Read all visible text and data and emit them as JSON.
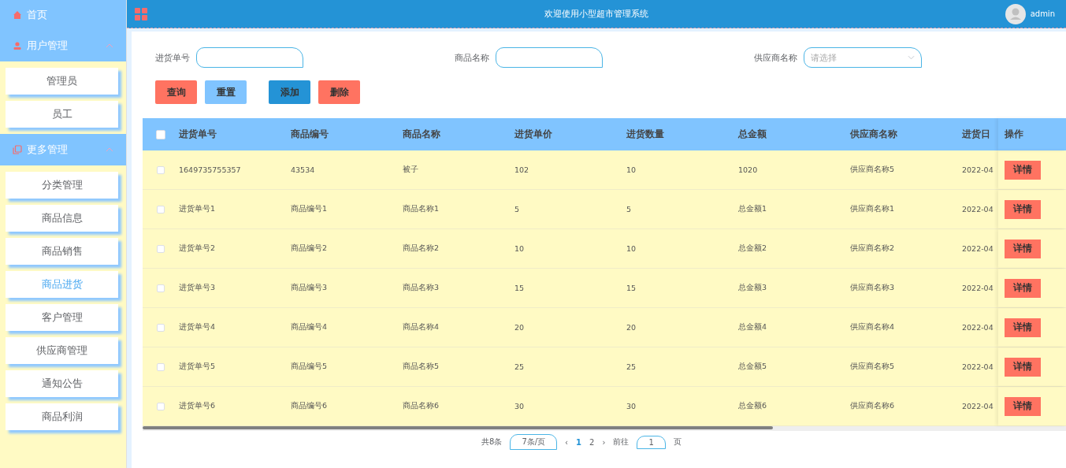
{
  "sidebar": {
    "home": {
      "label": "首页"
    },
    "groups": [
      {
        "label": "用户管理",
        "expanded": true,
        "items": [
          {
            "label": "管理员",
            "selected": false
          },
          {
            "label": "员工",
            "selected": false
          }
        ]
      },
      {
        "label": "更多管理",
        "expanded": true,
        "items": [
          {
            "label": "分类管理",
            "selected": false
          },
          {
            "label": "商品信息",
            "selected": false
          },
          {
            "label": "商品销售",
            "selected": false
          },
          {
            "label": "商品进货",
            "selected": true
          },
          {
            "label": "客户管理",
            "selected": false
          },
          {
            "label": "供应商管理",
            "selected": false
          },
          {
            "label": "通知公告",
            "selected": false
          },
          {
            "label": "商品利润",
            "selected": false
          }
        ]
      }
    ]
  },
  "header": {
    "title": "欢迎使用小型超市管理系统",
    "user": "admin"
  },
  "filters": [
    {
      "label": "进货单号",
      "kind": "input"
    },
    {
      "label": "商品名称",
      "kind": "input"
    },
    {
      "label": "供应商名称",
      "kind": "select",
      "placeholder": "请选择"
    }
  ],
  "buttons": [
    {
      "label": "查询",
      "kind": "danger"
    },
    {
      "label": "重置",
      "kind": "light"
    },
    {
      "label": "添加",
      "kind": "primary"
    },
    {
      "label": "删除",
      "kind": "danger"
    }
  ],
  "table": {
    "columns": [
      "进货单号",
      "商品编号",
      "商品名称",
      "进货单价",
      "进货数量",
      "总金额",
      "供应商名称",
      "进货日"
    ],
    "action_column": "操作",
    "all_checked": false,
    "rows": [
      {
        "checked": false,
        "cells": [
          "1649735755357",
          "43534",
          "被子",
          "102",
          "10",
          "1020",
          "供应商名称5",
          "2022-04"
        ],
        "action": "详情"
      },
      {
        "checked": false,
        "cells": [
          "进货单号1",
          "商品编号1",
          "商品名称1",
          "5",
          "5",
          "总金额1",
          "供应商名称1",
          "2022-04"
        ],
        "action": "详情"
      },
      {
        "checked": false,
        "cells": [
          "进货单号2",
          "商品编号2",
          "商品名称2",
          "10",
          "10",
          "总金额2",
          "供应商名称2",
          "2022-04"
        ],
        "action": "详情"
      },
      {
        "checked": false,
        "cells": [
          "进货单号3",
          "商品编号3",
          "商品名称3",
          "15",
          "15",
          "总金额3",
          "供应商名称3",
          "2022-04"
        ],
        "action": "详情"
      },
      {
        "checked": false,
        "cells": [
          "进货单号4",
          "商品编号4",
          "商品名称4",
          "20",
          "20",
          "总金额4",
          "供应商名称4",
          "2022-04"
        ],
        "action": "详情"
      },
      {
        "checked": false,
        "cells": [
          "进货单号5",
          "商品编号5",
          "商品名称5",
          "25",
          "25",
          "总金额5",
          "供应商名称5",
          "2022-04"
        ],
        "action": "详情"
      },
      {
        "checked": false,
        "cells": [
          "进货单号6",
          "商品编号6",
          "商品名称6",
          "30",
          "30",
          "总金额6",
          "供应商名称6",
          "2022-04"
        ],
        "action": "详情"
      }
    ]
  },
  "pagination": {
    "total": "共8条",
    "page_size": "7条/页",
    "prev": "‹",
    "pages": [
      {
        "label": "1",
        "selected": true
      },
      {
        "label": "2",
        "selected": false
      }
    ],
    "next": "›",
    "goto": "前往",
    "goto_value": "1",
    "goto_suffix": "页"
  }
}
